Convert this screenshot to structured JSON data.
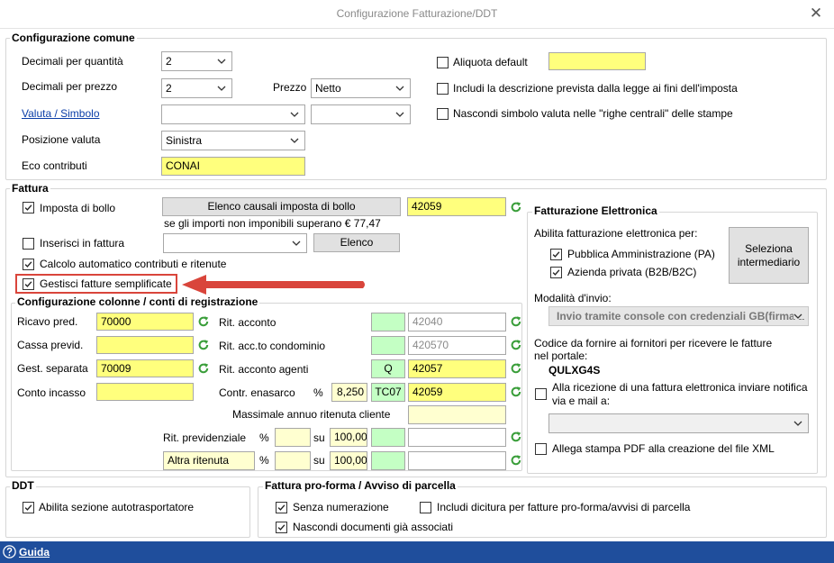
{
  "window": {
    "title": "Configurazione Fatturazione/DDT"
  },
  "comune": {
    "title": "Configurazione comune",
    "dec_qty_label": "Decimali per quantità",
    "dec_qty_value": "2",
    "dec_price_label": "Decimali per prezzo",
    "dec_price_value": "2",
    "prezzo_label": "Prezzo",
    "prezzo_value": "Netto",
    "valuta_link": "Valuta / Simbolo",
    "posizione_label": "Posizione valuta",
    "posizione_value": "Sinistra",
    "eco_label": "Eco contributi",
    "eco_value": "CONAI",
    "aliquota_label": "Aliquota default",
    "includi_desc_label": "Includi la descrizione prevista dalla legge ai fini dell'imposta",
    "nascondi_simbolo_label": "Nascondi simbolo valuta nelle \"righe centrali\" delle stampe"
  },
  "fattura": {
    "title": "Fattura",
    "bollo_label": "Imposta di bollo",
    "bollo_button": "Elenco causali imposta di bollo",
    "bollo_code": "42059",
    "bollo_note": "se gli importi non imponibili superano € 77,47",
    "inserisci_label": "Inserisci in fattura",
    "elenco_button": "Elenco",
    "calcolo_label": "Calcolo automatico contributi e ritenute",
    "semplificate_label": "Gestisci fatture semplificate"
  },
  "conti": {
    "title": "Configurazione colonne / conti di registrazione",
    "ricavo_label": "Ricavo pred.",
    "ricavo_value": "70000",
    "cassa_label": "Cassa previd.",
    "gest_label": "Gest. separata",
    "gest_value": "70009",
    "incasso_label": "Conto incasso",
    "rit_acconto_label": "Rit. acconto",
    "rit_acconto_value": "42040",
    "rit_condominio_label": "Rit. acc.to condominio",
    "rit_condominio_value": "420570",
    "rit_agenti_label": "Rit. acconto agenti",
    "rit_agenti_code": "Q",
    "rit_agenti_value": "42057",
    "enasarco_label": "Contr. enasarco",
    "percent": "%",
    "enasarco_pct": "8,250",
    "enasarco_code": "TC07",
    "enasarco_value": "42059",
    "massimale_label": "Massimale annuo ritenuta cliente",
    "rit_prev_label": "Rit. previdenziale",
    "su": "su",
    "rit_prev_base": "100,00",
    "altra_ritenuta": "Altra ritenuta",
    "altra_base": "100,00"
  },
  "fe": {
    "title": "Fatturazione Elettronica",
    "abilita_label": "Abilita fatturazione elettronica per:",
    "pa_label": "Pubblica Amministrazione (PA)",
    "b2b_label": "Azienda privata (B2B/B2C)",
    "seleziona_line1": "Seleziona",
    "seleziona_line2": "intermediario",
    "modalita_label": "Modalità d'invio:",
    "modalita_value": "Invio tramite console con credenziali GB(firma a",
    "codice_line1": "Codice da fornire ai fornitori per ricevere le fatture",
    "codice_line2": "nel portale:",
    "codice_value": "QULXG4S",
    "notifica_line1": "Alla ricezione di una fattura elettronica inviare notifica",
    "notifica_line2": "via e mail a:",
    "allega_label": "Allega stampa PDF alla creazione del file XML"
  },
  "ddt": {
    "title": "DDT",
    "autotrasp_label": "Abilita sezione autotrasportatore"
  },
  "proforma": {
    "title": "Fattura pro-forma / Avviso di parcella",
    "senza_label": "Senza numerazione",
    "includi_label": "Includi dicitura per fatture pro-forma/avvisi di parcella",
    "nascondi_label": "Nascondi documenti già associati"
  },
  "footer": {
    "guida": "Guida"
  },
  "colors": {
    "yellow": "#ffff7d",
    "light_green": "#c4ffc4",
    "light_yellow": "#ffffd0",
    "footer_blue": "#1f4e9c",
    "annotation_red": "#d9453b",
    "refresh_green": "#3a9e3a"
  },
  "checkboxes": {
    "aliquota": false,
    "includi_desc": false,
    "nascondi_simbolo": false,
    "bollo": true,
    "inserisci": false,
    "calcolo": true,
    "semplificate": true,
    "pa": true,
    "b2b": true,
    "notifica": false,
    "allega": false,
    "autotrasp": true,
    "senza": true,
    "includi_proforma": false,
    "nascondi_doc": true
  },
  "annotation": {
    "type": "red-arrow",
    "target": "Gestisci fatture semplificate"
  }
}
